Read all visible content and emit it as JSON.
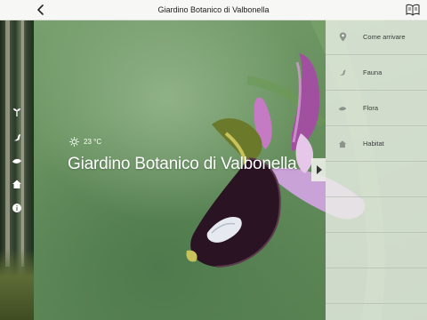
{
  "header": {
    "title": "Giardino Botanico di Valbonella"
  },
  "weather": {
    "temperature": "23 °C"
  },
  "hero": {
    "title": "Giardino Botanico di Valbonella"
  },
  "menu": {
    "items": [
      {
        "label": "Come arrivare",
        "icon": "location-pin-icon"
      },
      {
        "label": "Fauna",
        "icon": "bird-icon"
      },
      {
        "label": "Flora",
        "icon": "leaf-icon"
      },
      {
        "label": "Habitat",
        "icon": "home-icon"
      }
    ]
  },
  "left_rail": {
    "icons": [
      "plant-icon",
      "bird-icon",
      "leaf-icon",
      "home-icon",
      "info-icon"
    ]
  },
  "colors": {
    "panel": "#ECF0E8",
    "topbar": "#F7F7F5",
    "hero_text": "#FFFFFF"
  }
}
